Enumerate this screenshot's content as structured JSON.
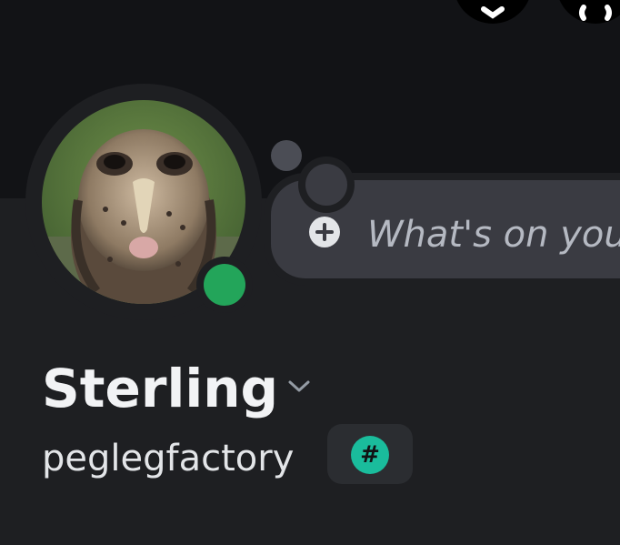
{
  "colors": {
    "background": "#1e1f22",
    "banner": "#121316",
    "status_online": "#23a55a",
    "bubble": "#3a3b42",
    "hash_badge": "#1abc9c",
    "text_primary": "#f2f3f5",
    "text_muted": "#b5b9c2"
  },
  "profile": {
    "display_name": "Sterling",
    "username": "peglegfactory",
    "status": "online",
    "avatar_description": "owl"
  },
  "status_bubble": {
    "placeholder": "What's on you"
  },
  "tag": {
    "symbol": "#"
  },
  "icons": {
    "top_buttons": [
      "shop-icon",
      "nitro-icon"
    ],
    "add_status": "plus-circle-icon",
    "expand": "chevron-down-icon"
  }
}
